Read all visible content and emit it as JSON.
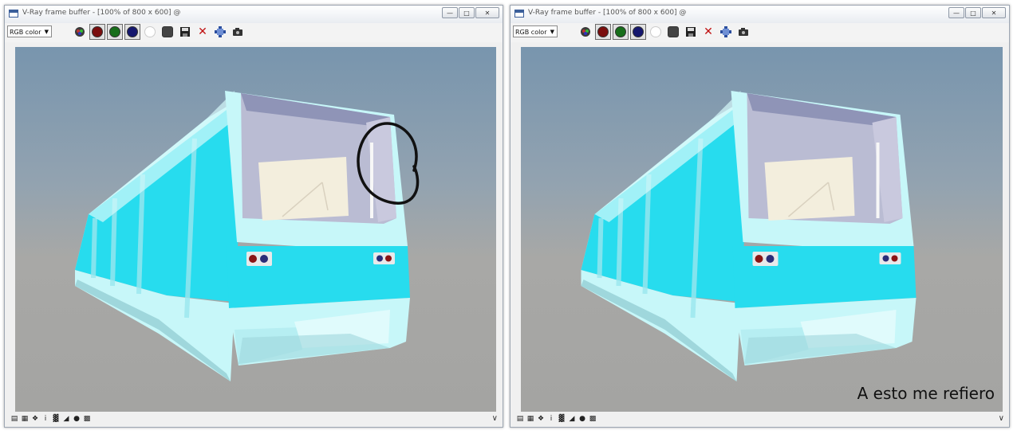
{
  "left_window": {
    "title": "V-Ray frame buffer - [100% of 800 x 600] @",
    "channel_select": "RGB color",
    "has_annotation_circle": true
  },
  "right_window": {
    "title": "V-Ray frame buffer - [100% of 800 x 600] @",
    "channel_select": "RGB color",
    "caption": "A esto me refiero"
  },
  "toolbar_icons": [
    "track-mouse-icon",
    "red-channel-icon",
    "green-channel-icon",
    "blue-channel-icon",
    "alpha-channel-icon",
    "mono-icon",
    "save-icon",
    "clear-icon",
    "vfb-history-icon",
    "camera-icon"
  ],
  "status_icons": [
    "display-icon",
    "region-icon",
    "color-corrections-icon",
    "info-icon",
    "histogram-icon",
    "lut-icon",
    "stamp-icon",
    "dots-icon"
  ],
  "colors": {
    "red_channel": "#7a0d0d",
    "green_channel": "#176e1a",
    "blue_channel": "#15176e",
    "train_cyan": "#27dcee",
    "train_light": "#c7f7f9",
    "annotation": "#111111"
  }
}
